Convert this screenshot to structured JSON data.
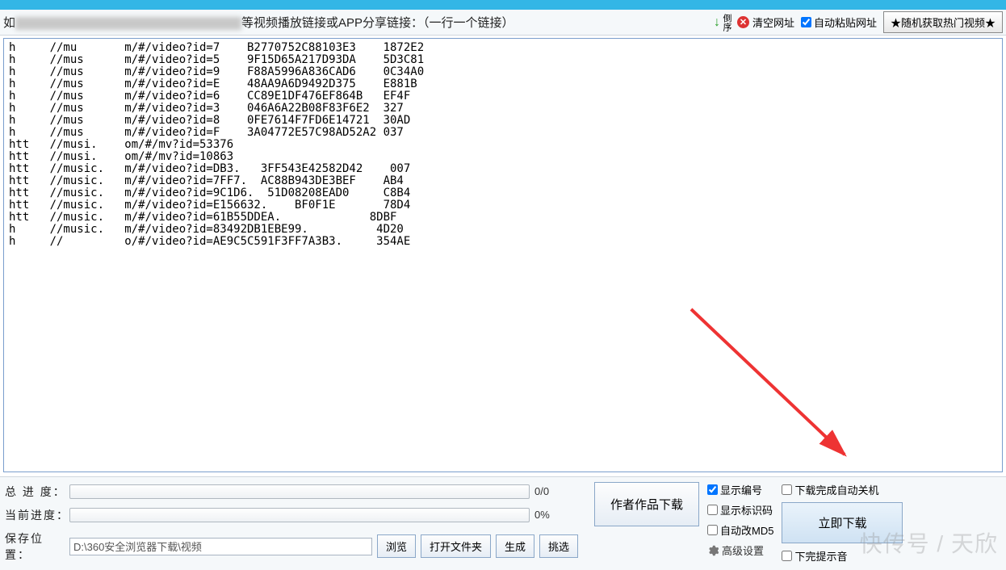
{
  "toolbar": {
    "instruction_tail": "等视频播放链接或APP分享链接：（一行一个链接）",
    "sort_label": "倒序",
    "clear_label": "清空网址",
    "auto_paste_label": "自动粘贴网址",
    "random_hot_label": "★随机获取热门视频★"
  },
  "urls": [
    "h     //mu       m/#/video?id=7    B2770752C88103E3    1872E2",
    "h     //mus      m/#/video?id=5    9F15D65A217D93DA    5D3C81",
    "h     //mus      m/#/video?id=9    F88A5996A836CAD6    0C34A0",
    "h     //mus      m/#/video?id=E    48AA9A6D9492D375    E881B",
    "h     //mus      m/#/video?id=6    CC89E1DF476EF864B   EF4F",
    "h     //mus      m/#/video?id=3    046A6A22B08F83F6E2  327",
    "h     //mus      m/#/video?id=8    0FE7614F7FD6E14721  30AD",
    "h     //mus      m/#/video?id=F    3A04772E57C98AD52A2 037",
    "htt   //musi.    om/#/mv?id=53376",
    "htt   //musi.    om/#/mv?id=10863",
    "htt   //music.   m/#/video?id=DB3.   3FF543E42582D42    007",
    "htt   //music.   m/#/video?id=7FF7.  AC88B943DE3BEF    AB4",
    "htt   //music.   m/#/video?id=9C1D6.  51D08208EAD0     C8B4",
    "htt   //music.   m/#/video?id=E156632.    BF0F1E       78D4",
    "htt   //music.   m/#/video?id=61B55DDEA.             8DBF",
    "h     //music.   m/#/video?id=83492DB1EBE99.          4D20",
    "h     //         o/#/video?id=AE9C5C591F3FF7A3B3.     354AE"
  ],
  "progress": {
    "total_label": "总 进 度：",
    "total_text": "0/0",
    "current_label": "当前进度：",
    "current_text": "0%"
  },
  "save": {
    "label": "保存位置：",
    "path": "D:\\360安全浏览器下载\\视频",
    "browse": "浏览",
    "open_folder": "打开文件夹",
    "generate": "生成",
    "pick": "挑选"
  },
  "buttons": {
    "author_works": "作者作品下载",
    "download_now": "立即下载"
  },
  "options": {
    "show_number": "显示编号",
    "show_id": "显示标识码",
    "auto_md5": "自动改MD5",
    "advanced": "高级设置",
    "auto_shutdown": "下载完成自动关机",
    "finish_sound": "下完提示音"
  },
  "watermark": "快传号 / 天欣"
}
